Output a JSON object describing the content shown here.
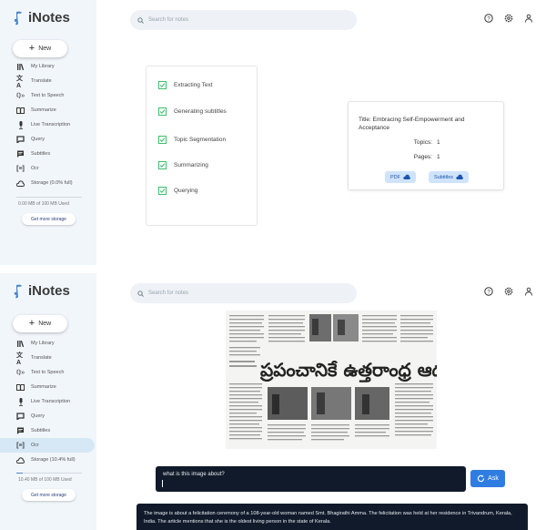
{
  "app": {
    "name": "iNotes"
  },
  "search": {
    "placeholder": "Search for notes"
  },
  "sidebar": {
    "new_label": "New",
    "items": [
      {
        "label": "My Library",
        "icon": "library-icon"
      },
      {
        "label": "Translate",
        "icon": "translate-icon"
      },
      {
        "label": "Text to Speech",
        "icon": "text-to-speech-icon"
      },
      {
        "label": "Summarize",
        "icon": "book-icon"
      },
      {
        "label": "Live Transcription",
        "icon": "microphone-icon"
      },
      {
        "label": "Query",
        "icon": "chat-icon"
      },
      {
        "label": "Subtitles",
        "icon": "subtitles-icon"
      },
      {
        "label": "Ocr",
        "icon": "ocr-icon"
      }
    ]
  },
  "top": {
    "storage_label": "Storage (0.0% full)",
    "storage_used": "0.00 MB of 100 MB Used",
    "storage_fraction": 0.0,
    "more_storage": "Get more storage",
    "steps": [
      "Extracting Text",
      "Generating subtitles",
      "Topic Segmentation",
      "Summarizing",
      "Querying"
    ],
    "result": {
      "title": "Title: Embracing Self-Empowerment and Acceptance",
      "topics_label": "Topics:",
      "topics_value": "1",
      "pages_label": "Pages:",
      "pages_value": "1",
      "pdf_label": "PDF",
      "subtitles_label": "Subtitles"
    }
  },
  "bottom": {
    "storage_label": "Storage (10.4% full)",
    "storage_used": "10.40 MB of 100 MB Used",
    "storage_fraction": 0.104,
    "more_storage": "Get more storage",
    "active_item": "Ocr",
    "newspaper_headline": "ప్రపంచానికే ఉత్తరాంధ్ర ఆదర్శం",
    "question": "what is this image about?",
    "ask_label": "Ask",
    "answer": "The image is about a felicitation ceremony of a 108-year-old woman named Smt. Bhagirathi Amma. The felicitation was held at her residence in Trivandrum, Kerala, India. The article mentions that she is the oldest living person in the state of Kerala."
  },
  "colors": {
    "sidebar_bg": "#f1f6fb",
    "accent": "#2f7de1",
    "dark": "#101a2a",
    "check": "#3cbf6a"
  }
}
